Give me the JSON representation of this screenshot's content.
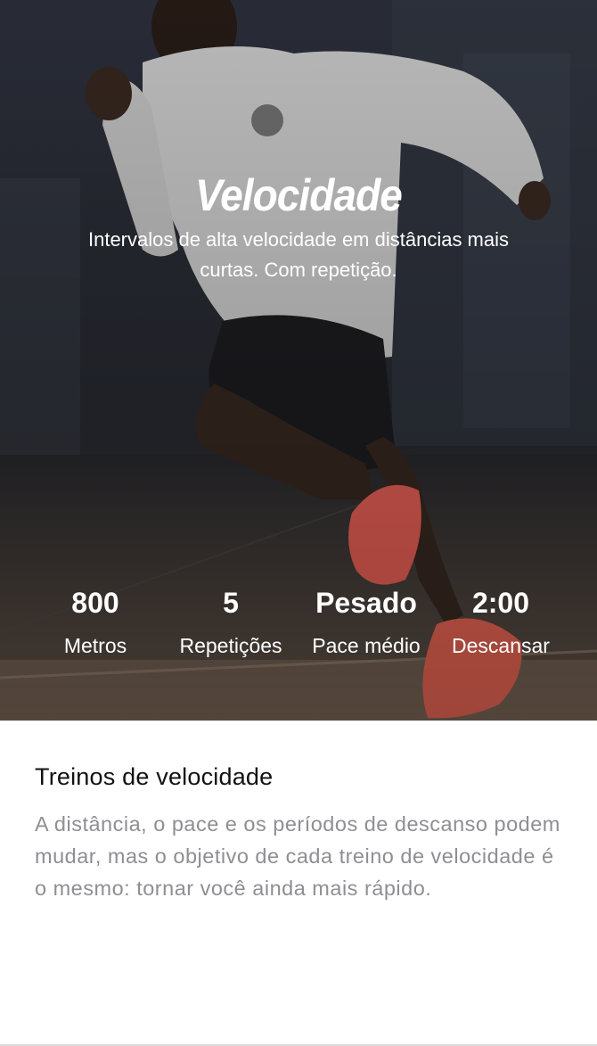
{
  "hero": {
    "title": "Velocidade",
    "subtitle": "Intervalos de alta velocidade em distâncias mais curtas. Com repetição.",
    "image": "runner-sprinting-photo"
  },
  "stats": [
    {
      "value": "800",
      "label": "Metros"
    },
    {
      "value": "5",
      "label": "Repetições"
    },
    {
      "value": "Pesado",
      "label": "Pace médio"
    },
    {
      "value": "2:00",
      "label": "Descansar"
    }
  ],
  "details": {
    "title": "Treinos de velocidade",
    "body": "A distância, o pace e os períodos de descanso podem mudar, mas o objetivo de cada treino de velocidade é o mesmo: tornar você ainda mais rápido."
  },
  "colors": {
    "shoe": "#f5655a",
    "body_text": "#8e8e93",
    "title_text": "#111111"
  }
}
